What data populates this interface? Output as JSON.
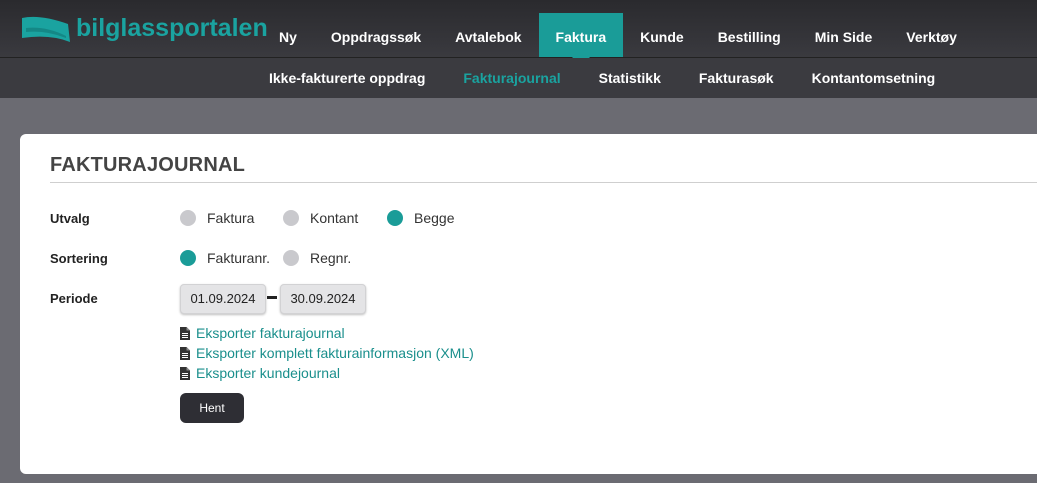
{
  "brand": {
    "name": "bilglassportalen",
    "accent": "#1a9c98"
  },
  "main_nav": [
    {
      "label": "Ny",
      "active": false
    },
    {
      "label": "Oppdragssøk",
      "active": false
    },
    {
      "label": "Avtalebok",
      "active": false
    },
    {
      "label": "Faktura",
      "active": true
    },
    {
      "label": "Kunde",
      "active": false
    },
    {
      "label": "Bestilling",
      "active": false
    },
    {
      "label": "Min Side",
      "active": false
    },
    {
      "label": "Verktøy",
      "active": false
    }
  ],
  "sub_nav": [
    {
      "label": "Ikke-fakturerte oppdrag",
      "active": false
    },
    {
      "label": "Fakturajournal",
      "active": true
    },
    {
      "label": "Statistikk",
      "active": false
    },
    {
      "label": "Fakturasøk",
      "active": false
    },
    {
      "label": "Kontantomsetning",
      "active": false
    }
  ],
  "panel": {
    "title": "FAKTURAJOURNAL",
    "utvalg": {
      "label": "Utvalg",
      "options": [
        {
          "label": "Faktura",
          "selected": false
        },
        {
          "label": "Kontant",
          "selected": false
        },
        {
          "label": "Begge",
          "selected": true
        }
      ]
    },
    "sortering": {
      "label": "Sortering",
      "options": [
        {
          "label": "Fakturanr.",
          "selected": true
        },
        {
          "label": "Regnr.",
          "selected": false
        }
      ]
    },
    "periode": {
      "label": "Periode",
      "from": "01.09.2024",
      "to": "30.09.2024"
    },
    "links": [
      "Eksporter fakturajournal",
      "Eksporter komplett fakturainformasjon (XML)",
      "Eksporter kundejournal"
    ],
    "fetch_button": "Hent"
  }
}
